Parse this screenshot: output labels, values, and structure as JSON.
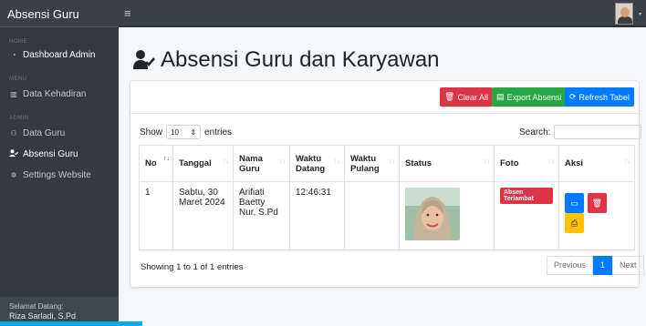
{
  "brand": "Absensi Guru",
  "sidebar": {
    "sections": [
      "HOME",
      "MENU",
      "ADMIN"
    ],
    "items": [
      {
        "label": "Dashboard Admin",
        "icon": "dashboard-icon"
      },
      {
        "label": "Data Kehadiran",
        "icon": "chart-icon"
      },
      {
        "label": "Data Guru",
        "icon": "users-icon"
      },
      {
        "label": "Absensi Guru",
        "icon": "user-check-icon"
      },
      {
        "label": "Settings Website",
        "icon": "gear-icon"
      }
    ],
    "footer_label": "Selamat Datang:",
    "footer_name": "Riza Sarladi, S.Pd"
  },
  "page_title": "Absensi Guru dan Karyawan",
  "toolbar": {
    "clear_label": "Clear All",
    "export_label": "Export Absensi",
    "refresh_label": "Refresh Tabel"
  },
  "table_controls": {
    "show_label": "Show",
    "length_value": "10",
    "entries_label": "entries",
    "search_label": "Search:"
  },
  "table": {
    "columns": [
      "No",
      "Tanggal",
      "Nama Guru",
      "Waktu Datang",
      "Waktu Pulang",
      "Status",
      "Foto",
      "Aksi"
    ],
    "rows": [
      {
        "no": "1",
        "tanggal": "Sabtu, 30 Maret 2024",
        "nama": "Arifiati Baetty Nur, S.Pd",
        "datang": "12:46:31",
        "pulang": "",
        "status_photo": "selfie-photo",
        "foto_badge": "Absen Terlambat"
      }
    ]
  },
  "footer": {
    "info": "Showing 1 to 1 of 1 entries",
    "previous": "Previous",
    "page": "1",
    "next": "Next"
  },
  "colors": {
    "sidebar": "#343a40",
    "danger": "#dc3545",
    "success": "#28a745",
    "primary": "#007bff",
    "warning": "#ffc107",
    "info": "#17a2b8"
  }
}
